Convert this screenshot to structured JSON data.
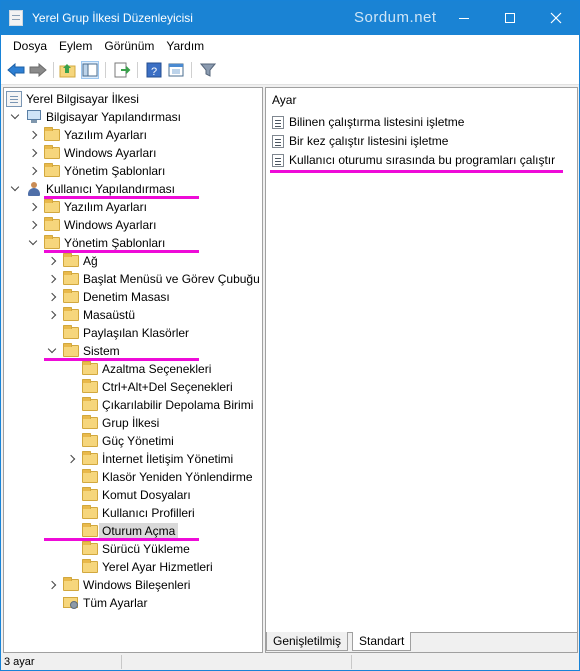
{
  "window": {
    "title": "Yerel Grup İlkesi Düzenleyicisi",
    "watermark": "Sordum.net"
  },
  "menu": [
    "Dosya",
    "Eylem",
    "Görünüm",
    "Yardım"
  ],
  "toolbar": [
    "back-arrow-icon",
    "forward-arrow-icon",
    "up-folder-icon",
    "show-hide-tree-icon",
    "export-list-icon",
    "help-icon",
    "properties-icon",
    "filter-icon"
  ],
  "tree": {
    "root": "Yerel Bilgisayar İlkesi",
    "computer_config": "Bilgisayar Yapılandırması",
    "cc_software": "Yazılım Ayarları",
    "cc_windows": "Windows Ayarları",
    "cc_templates": "Yönetim Şablonları",
    "user_config": "Kullanıcı Yapılandırması",
    "uc_software": "Yazılım Ayarları",
    "uc_windows": "Windows Ayarları",
    "uc_templates": "Yönetim Şablonları",
    "network": "Ağ",
    "start_menu": "Başlat Menüsü ve Görev Çubuğu",
    "control_panel": "Denetim Masası",
    "desktop": "Masaüstü",
    "shared_folders": "Paylaşılan Klasörler",
    "system": "Sistem",
    "mitigation": "Azaltma Seçenekleri",
    "ctrl_alt_del": "Ctrl+Alt+Del Seçenekleri",
    "removable": "Çıkarılabilir Depolama Birimi",
    "group_policy": "Grup İlkesi",
    "power": "Güç Yönetimi",
    "internet_comm": "İnternet İletişim Yönetimi",
    "folder_redirect": "Klasör Yeniden Yönlendirme",
    "scripts": "Komut Dosyaları",
    "user_profiles": "Kullanıcı Profilleri",
    "logon": "Oturum Açma",
    "driver_install": "Sürücü Yükleme",
    "locale_services": "Yerel Ayar Hizmetleri",
    "windows_components": "Windows Bileşenleri",
    "all_settings": "Tüm Ayarlar"
  },
  "right": {
    "header": "Ayar",
    "settings": [
      "Bilinen çalıştırma listesini işletme",
      "Bir kez çalıştır listesini işletme",
      "Kullanıcı oturumu sırasında bu programları çalıştır"
    ]
  },
  "tabs": [
    "Genişletilmiş",
    "Standart"
  ],
  "status": "3 ayar",
  "colors": {
    "titlebar": "#1a83d4",
    "highlight_line": "#ee0bd8"
  }
}
